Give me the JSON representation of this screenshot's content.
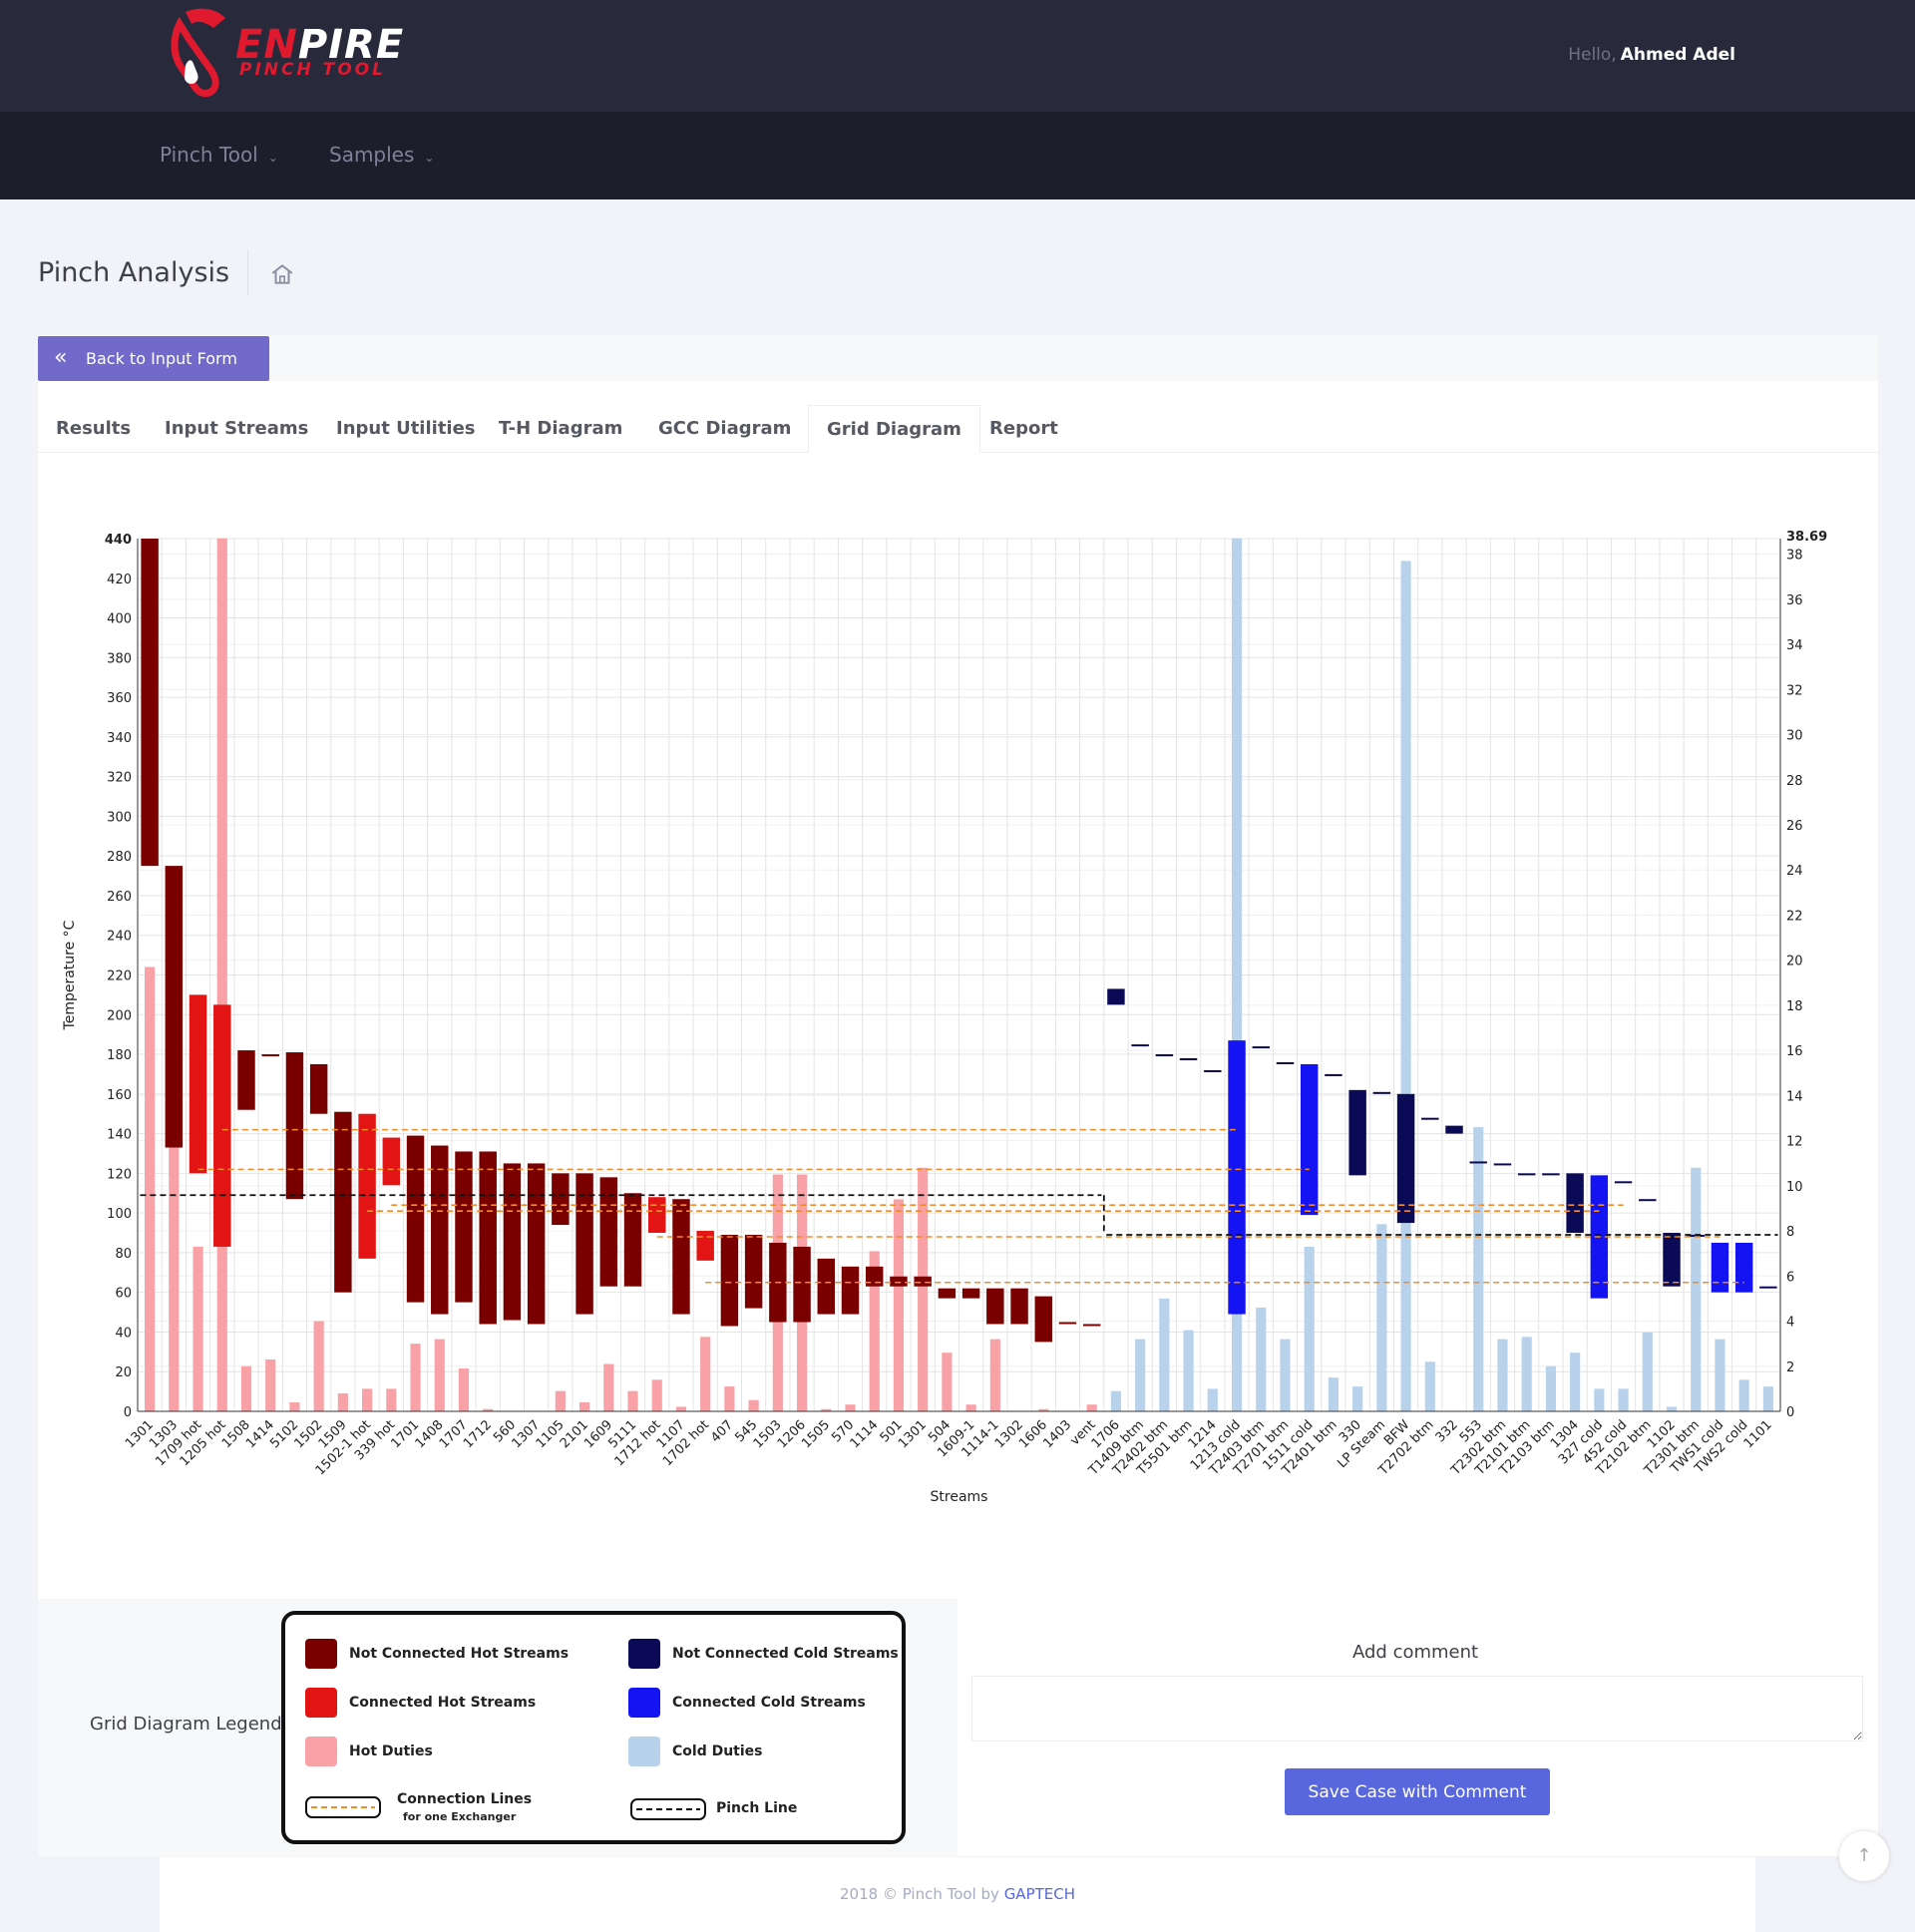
{
  "header": {
    "logo_main_pre": "EN",
    "logo_main_post": "PIRE",
    "logo_sub": "PINCH TOOL",
    "greeting": "Hello,",
    "user": "Ahmed Adel"
  },
  "nav": [
    {
      "label": "Pinch Tool"
    },
    {
      "label": "Samples"
    }
  ],
  "page": {
    "title": "Pinch Analysis"
  },
  "back_button": "Back to Input Form",
  "tabs": [
    "Results",
    "Input Streams",
    "Input Utilities",
    "T-H Diagram",
    "GCC Diagram",
    "Grid Diagram",
    "Report"
  ],
  "active_tab": "Grid Diagram",
  "legend": {
    "label": "Grid Diagram Legend",
    "items": [
      {
        "label": "Not Connected Hot Streams",
        "color": "#7a0000"
      },
      {
        "label": "Connected Hot Streams",
        "color": "#e31414"
      },
      {
        "label": "Hot Duties",
        "color": "#f8a1a6"
      },
      {
        "label": "Not Connected Cold Streams",
        "color": "#0a0a57"
      },
      {
        "label": "Connected Cold Streams",
        "color": "#1414f2"
      },
      {
        "label": "Cold Duties",
        "color": "#b8d2ec"
      }
    ],
    "conn_label": "Connection Lines",
    "conn_sub": "for one Exchanger",
    "pinch_label": "Pinch Line"
  },
  "comment": {
    "label": "Add comment",
    "placeholder": ""
  },
  "save_button": "Save Case with Comment",
  "footer": {
    "text": "2018 © Pinch Tool by ",
    "brand": "GAPTECH"
  },
  "chart_data": {
    "type": "bar",
    "xlabel": "Streams",
    "ylabel": "Temperature °C",
    "y2label": "Duty MM Kcal/hr",
    "ylim": [
      0,
      440
    ],
    "y2lim": [
      0,
      38.69
    ],
    "y2_top_label": "38.69",
    "grid": true,
    "categories": [
      "1301",
      "1303",
      "1709 hot",
      "1205 hot",
      "1508",
      "1414",
      "5102",
      "1502",
      "1509",
      "1502-1 hot",
      "339 hot",
      "1701",
      "1408",
      "1707",
      "1712",
      "560",
      "1307",
      "1105",
      "2101",
      "1609",
      "5111",
      "1712 hot",
      "1107",
      "1702 hot",
      "407",
      "545",
      "1503",
      "1206",
      "1505",
      "570",
      "1114",
      "501",
      "1301",
      "504",
      "1609-1",
      "1114-1",
      "1302",
      "1606",
      "1403",
      "vent",
      "1706",
      "T1409 btm",
      "T2402 btm",
      "T5501 btm",
      "1214",
      "1213 cold",
      "T2403 btm",
      "T2701 btm",
      "1511 cold",
      "T2401 btm",
      "330",
      "LP Steam",
      "BFW",
      "T2702 btm",
      "332",
      "553",
      "T2302 btm",
      "T2101 btm",
      "T2103 btm",
      "1304",
      "327 cold",
      "452 cold",
      "T2102 btm",
      "1102",
      "T2301 btm",
      "TWS1 cold",
      "TWS2 cold",
      "1101"
    ],
    "hot_count": 40,
    "temp_ranges": [
      [
        275,
        440
      ],
      [
        133,
        275
      ],
      [
        120,
        210
      ],
      [
        83,
        205
      ],
      [
        152,
        182
      ],
      [
        180,
        180
      ],
      [
        107,
        181
      ],
      [
        150,
        175
      ],
      [
        60,
        151
      ],
      [
        77,
        150
      ],
      [
        114,
        138
      ],
      [
        55,
        139
      ],
      [
        49,
        134
      ],
      [
        55,
        131
      ],
      [
        44,
        131
      ],
      [
        46,
        125
      ],
      [
        44,
        125
      ],
      [
        94,
        120
      ],
      [
        49,
        120
      ],
      [
        63,
        118
      ],
      [
        63,
        110
      ],
      [
        90,
        108
      ],
      [
        49,
        107
      ],
      [
        76,
        91
      ],
      [
        43,
        89
      ],
      [
        52,
        89
      ],
      [
        45,
        85
      ],
      [
        45,
        83
      ],
      [
        49,
        77
      ],
      [
        49,
        73
      ],
      [
        63,
        73
      ],
      [
        63,
        68
      ],
      [
        63,
        68
      ],
      [
        57,
        62
      ],
      [
        57,
        62
      ],
      [
        44,
        62
      ],
      [
        44,
        62
      ],
      [
        35,
        58
      ],
      [
        45,
        45
      ],
      [
        44,
        44
      ],
      [
        205,
        213
      ],
      [
        185,
        185
      ],
      [
        180,
        180
      ],
      [
        178,
        178
      ],
      [
        172,
        172
      ],
      [
        49,
        187
      ],
      [
        184,
        184
      ],
      [
        176,
        176
      ],
      [
        99,
        175
      ],
      [
        170,
        170
      ],
      [
        119,
        162
      ],
      [
        161,
        161
      ],
      [
        95,
        160
      ],
      [
        148,
        148
      ],
      [
        140,
        144
      ],
      [
        126,
        126
      ],
      [
        125,
        125
      ],
      [
        120,
        120
      ],
      [
        120,
        120
      ],
      [
        90,
        120
      ],
      [
        57,
        119
      ],
      [
        116,
        116
      ],
      [
        107,
        107
      ],
      [
        63,
        90
      ],
      [
        89,
        89
      ],
      [
        60,
        85
      ],
      [
        60,
        85
      ],
      [
        63,
        63
      ]
    ],
    "status": [
      "NH",
      "NH",
      "CH",
      "CH",
      "NH",
      "NH",
      "NH",
      "NH",
      "NH",
      "CH",
      "CH",
      "NH",
      "NH",
      "NH",
      "NH",
      "NH",
      "NH",
      "NH",
      "NH",
      "NH",
      "NH",
      "CH",
      "NH",
      "CH",
      "NH",
      "NH",
      "NH",
      "NH",
      "NH",
      "NH",
      "NH",
      "NH",
      "NH",
      "NH",
      "NH",
      "NH",
      "NH",
      "NH",
      "NH",
      "NH",
      "NC",
      "NC",
      "NC",
      "NC",
      "NC",
      "CC",
      "NC",
      "NC",
      "CC",
      "NC",
      "NC",
      "NC",
      "NC",
      "NC",
      "NC",
      "NC",
      "NC",
      "NC",
      "NC",
      "NC",
      "CC",
      "NC",
      "NC",
      "NC",
      "NC",
      "CC",
      "CC",
      "NC"
    ],
    "duties": [
      19.7,
      17.9,
      7.3,
      38.7,
      2.0,
      2.3,
      0.4,
      4.0,
      0.8,
      1.0,
      1.0,
      3.0,
      3.2,
      1.9,
      0.1,
      0.0,
      0.0,
      0.9,
      0.4,
      2.1,
      0.9,
      1.4,
      0.2,
      3.3,
      1.1,
      0.5,
      10.5,
      10.5,
      0.1,
      0.3,
      7.1,
      9.4,
      10.8,
      2.6,
      0.3,
      3.2,
      0.0,
      0.1,
      0.0,
      0.3,
      0.9,
      3.2,
      5.0,
      3.6,
      1.0,
      38.7,
      4.6,
      3.2,
      7.3,
      1.5,
      1.1,
      8.3,
      37.7,
      2.2,
      0.0,
      12.6,
      3.2,
      3.3,
      2.0,
      2.6,
      1.0,
      1.0,
      3.5,
      0.2,
      10.8,
      3.2,
      1.4,
      1.1
    ],
    "pinch_line": [
      {
        "from": "1301",
        "to": "vent",
        "temp": 109
      },
      {
        "from": "1706",
        "to": "1101",
        "temp": 89
      }
    ],
    "connection_lines": [
      {
        "from": "1709 hot",
        "to": "1511 cold",
        "temp": 122
      },
      {
        "from": "1205 hot",
        "to": "1213 cold",
        "temp": 142
      },
      {
        "from": "1502-1 hot",
        "to": "327 cold",
        "temp": 101
      },
      {
        "from": "339 hot",
        "to": "452 cold",
        "temp": 104
      },
      {
        "from": "1712 hot",
        "to": "TWS1 cold",
        "temp": 88
      },
      {
        "from": "1702 hot",
        "to": "TWS2 cold",
        "temp": 65
      }
    ]
  }
}
